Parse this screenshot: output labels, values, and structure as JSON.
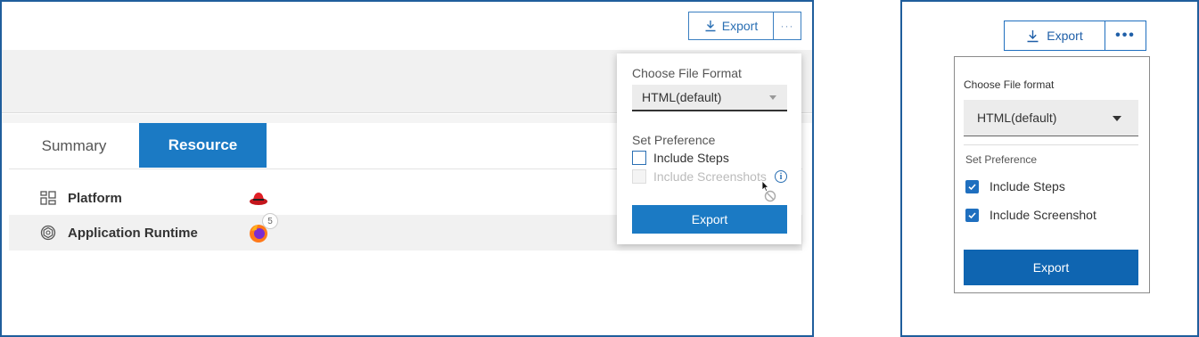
{
  "left": {
    "toolbar": {
      "export_label": "Export",
      "more_label": "···"
    },
    "tabs": [
      {
        "label": "Summary",
        "active": false
      },
      {
        "label": "Resource",
        "active": true
      }
    ],
    "rows": [
      {
        "label": "Platform",
        "icon": "grid-icon",
        "logo": "redhat-logo-icon"
      },
      {
        "label": "Application Runtime",
        "icon": "runtime-icon",
        "logo": "firefox-logo-icon",
        "badge": "5"
      }
    ],
    "popover": {
      "title": "Choose File Format",
      "select_value": "HTML(default)",
      "pref_title": "Set Preference",
      "checks": [
        {
          "label": "Include Steps",
          "checked": false,
          "disabled": false
        },
        {
          "label": "Include Screenshots",
          "checked": false,
          "disabled": true
        }
      ],
      "export_label": "Export"
    }
  },
  "right": {
    "toolbar": {
      "export_label": "Export",
      "more_label": "•••"
    },
    "popover": {
      "title": "Choose File format",
      "select_value": "HTML(default)",
      "pref_title": "Set Preference",
      "checks": [
        {
          "label": "Include Steps",
          "checked": true
        },
        {
          "label": "Include Screenshot",
          "checked": true
        }
      ],
      "export_label": "Export"
    }
  },
  "colors": {
    "accent": "#1b7ac4",
    "accent_dark": "#0f65b1",
    "frame": "#1f5e9c"
  }
}
